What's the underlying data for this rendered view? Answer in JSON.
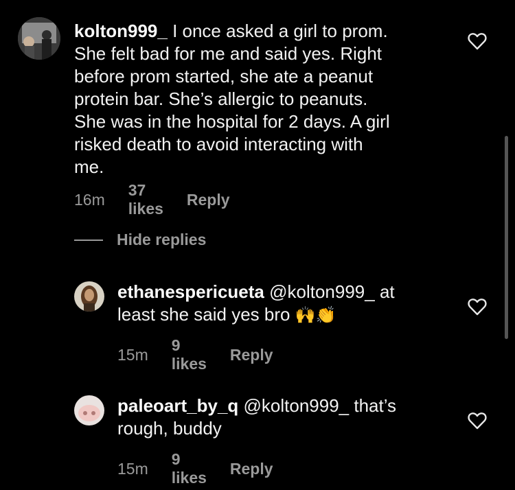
{
  "comments": [
    {
      "username": "kolton999_",
      "text": "I once asked a girl to prom.\nShe felt bad for me and said yes. Right\nbefore prom started, she ate a peanut\nprotein bar. She’s allergic to peanuts.\nShe was in the hospital for 2 days. A girl\nrisked death to avoid interacting with\nme.",
      "time": "16m",
      "likes": "37 likes",
      "reply": "Reply"
    },
    {
      "username": "ethanespericueta",
      "text": "@kolton999_ at\nleast she said yes bro",
      "emoji": "🙌👏",
      "time": "15m",
      "likes": "9 likes",
      "reply": "Reply"
    },
    {
      "username": "paleoart_by_q",
      "text": "@kolton999_ that’s\nrough, buddy",
      "time": "15m",
      "likes": "9 likes",
      "reply": "Reply"
    }
  ],
  "hide_replies_label": "Hide replies",
  "icons": {
    "like": "heart-outline-icon"
  }
}
